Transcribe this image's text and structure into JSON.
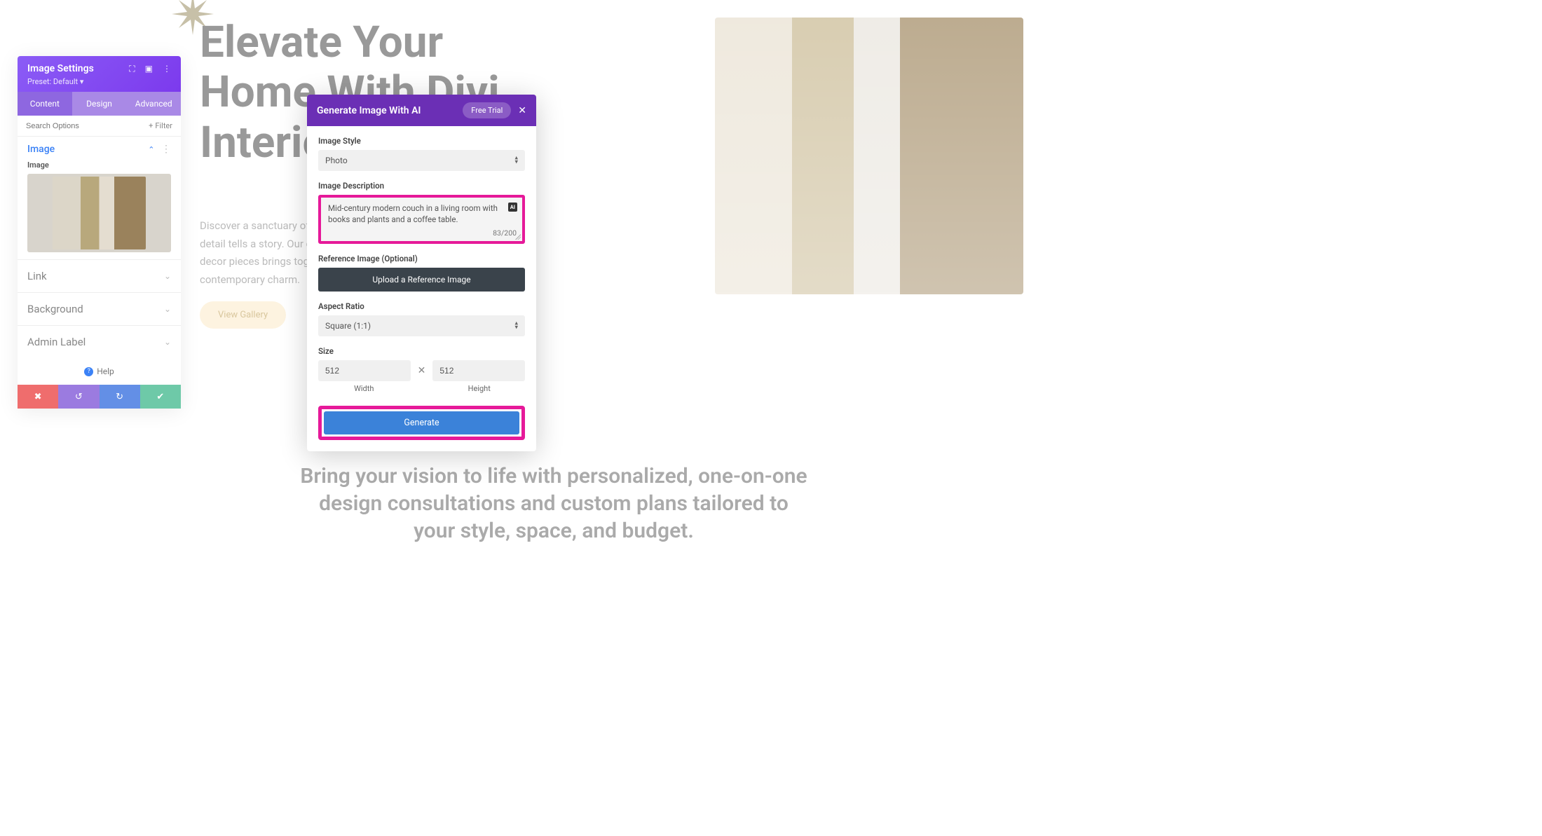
{
  "background": {
    "headline_line1": "Elevate Your",
    "headline_line2": "Home With Divi",
    "headline_line3": "Interior",
    "body": "Discover a sanctuary of sophistication where every detail tells a story. Our curated collection of home decor pieces brings together timeless elegance and contemporary charm.",
    "cta": "View Gallery",
    "subhead_l1": "Bring your vision to life with personalized, one-on-one",
    "subhead_l2": "design consultations and custom plans tailored to",
    "subhead_l3": "your style, space, and budget."
  },
  "settings": {
    "title": "Image Settings",
    "preset_label": "Preset: Default",
    "tabs": {
      "content": "Content",
      "design": "Design",
      "advanced": "Advanced"
    },
    "search_placeholder": "Search Options",
    "filter": "Filter",
    "sections": {
      "image_head": "Image",
      "image_field_label": "Image",
      "link": "Link",
      "background": "Background",
      "admin_label": "Admin Label"
    },
    "help": "Help"
  },
  "ai": {
    "title": "Generate Image With AI",
    "trial": "Free Trial",
    "style_label": "Image Style",
    "style_value": "Photo",
    "desc_label": "Image Description",
    "desc_value": "Mid-century modern couch in a living room with books and plants and a coffee table.",
    "desc_badge": "AI",
    "desc_count": "83/200",
    "ref_label": "Reference Image (Optional)",
    "upload_btn": "Upload a Reference Image",
    "aspect_label": "Aspect Ratio",
    "aspect_value": "Square (1:1)",
    "size_label": "Size",
    "width_value": "512",
    "height_value": "512",
    "width_label": "Width",
    "height_label": "Height",
    "generate": "Generate"
  }
}
